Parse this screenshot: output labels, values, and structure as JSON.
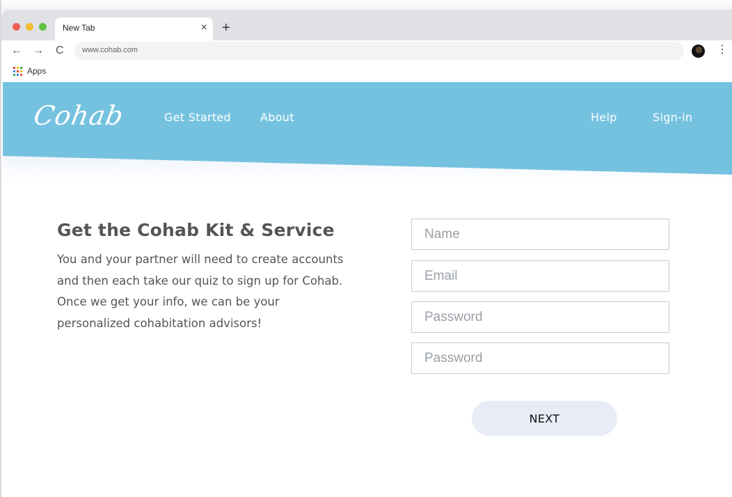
{
  "browser": {
    "tab_title": "New Tab",
    "tab_close_glyph": "×",
    "new_tab_glyph": "+",
    "url": "www.cohab.com",
    "back_glyph": "←",
    "forward_glyph": "→",
    "reload_glyph": "C",
    "menu_glyph": "⋮",
    "bookmarks": {
      "apps_label": "Apps"
    }
  },
  "site": {
    "logo": "Cohab",
    "nav": {
      "get_started": "Get Started",
      "about": "About",
      "help": "Help",
      "sign_in": "Sign-in"
    },
    "brand_color": "#75c2e0"
  },
  "main": {
    "heading": "Get the Cohab Kit & Service",
    "intro": "You and your partner will need to create accounts and then each take our quiz to sign up for Cohab. Once we get your info, we can be your personalized cohabitation advisors!",
    "form": {
      "name_placeholder": "Name",
      "email_placeholder": "Email",
      "password_placeholder": "Password",
      "password_confirm_placeholder": "Password",
      "next_label": "NEXT"
    }
  },
  "icons": [
    "back-arrow-icon",
    "forward-arrow-icon",
    "reload-icon",
    "apps-grid-icon",
    "profile-avatar-icon",
    "more-menu-icon",
    "close-icon",
    "plus-icon"
  ]
}
